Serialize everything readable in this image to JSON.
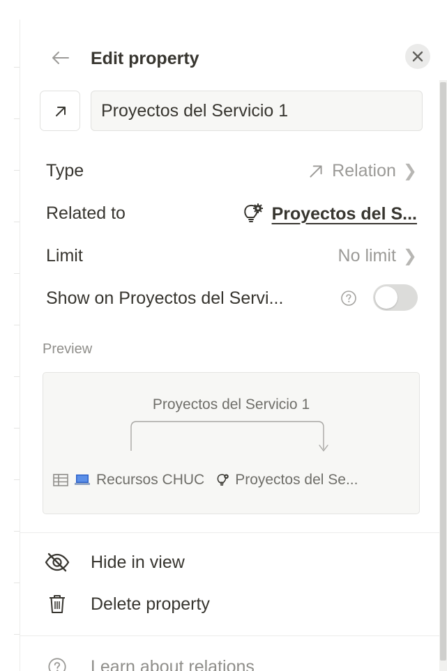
{
  "header": {
    "title": "Edit property",
    "back_icon": "arrow-left-icon",
    "close_icon": "close-icon"
  },
  "name_field": {
    "icon": "relation-arrow-icon",
    "value": "Proyectos del Servicio 1"
  },
  "properties": {
    "type": {
      "label": "Type",
      "value": "Relation",
      "icon": "relation-arrow-icon"
    },
    "related_to": {
      "label": "Related to",
      "value": "Proyectos del S...",
      "icon": "lightbulb-gear-icon"
    },
    "limit": {
      "label": "Limit",
      "value": "No limit"
    },
    "show_on": {
      "label": "Show on Proyectos del Servi...",
      "toggle_on": false
    }
  },
  "preview": {
    "label": "Preview",
    "property_name": "Proyectos del Servicio 1",
    "source_db": "Recursos CHUC",
    "source_icons": [
      "table-icon",
      "laptop-icon"
    ],
    "target_db": "Proyectos del Se...",
    "target_icon": "lightbulb-gear-icon"
  },
  "menu": [
    {
      "label": "Hide in view",
      "icon": "eye-slash-icon"
    },
    {
      "label": "Delete property",
      "icon": "trash-icon"
    }
  ],
  "footer": {
    "label": "Learn about relations",
    "icon": "help-circle-icon"
  },
  "colors": {
    "text": "#37352f",
    "muted": "#9b9a97",
    "input_bg": "#f7f7f5",
    "toggle_off": "#dcdcda"
  }
}
